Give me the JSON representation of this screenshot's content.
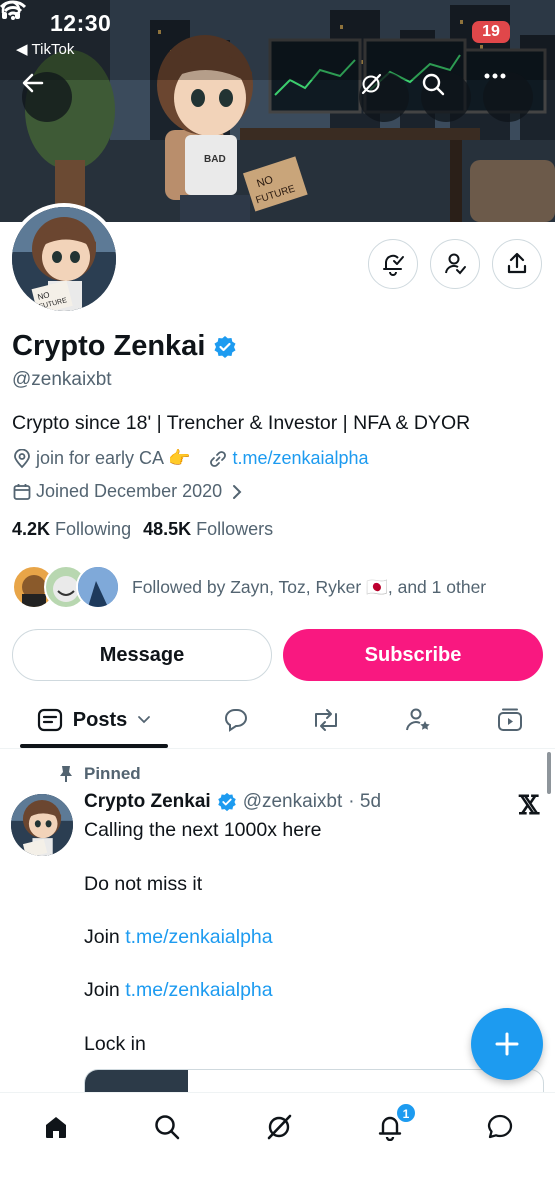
{
  "status_bar": {
    "time": "12:30",
    "back_app": "TikTok",
    "battery": "19"
  },
  "profile": {
    "display_name": "Crypto Zenkai",
    "handle": "@zenkaixbt",
    "bio": "Crypto since 18' | Trencher & Investor | NFA & DYOR",
    "location": "join for early CA 👉",
    "website": "t.me/zenkaialpha",
    "joined": "Joined December 2020",
    "following_count": "4.2K",
    "following_label": "Following",
    "followers_count": "48.5K",
    "followers_label": "Followers",
    "followed_by": "Followed by Zayn, Toz, Ryker 🇯🇵, and 1 other",
    "avatar_sign_text": "NO FUTURE",
    "banner_shirt_text": "BAD",
    "banner_sign_text": "NO FUTURE"
  },
  "buttons": {
    "message": "Message",
    "subscribe": "Subscribe"
  },
  "tabs": {
    "posts": "Posts"
  },
  "pinned_post": {
    "pinned_label": "Pinned",
    "author": "Crypto Zenkai",
    "handle": "@zenkaixbt",
    "time": "· 5d",
    "line1": "Calling the next 1000x here",
    "line2": "Do not miss it",
    "join_word": "Join",
    "join_link": "t.me/zenkaialpha",
    "line5": "Lock in"
  },
  "bottom_nav": {
    "notification_count": "1"
  },
  "colors": {
    "accent": "#1d9bf0",
    "subscribe": "#f91880",
    "text": "#0f1419",
    "muted": "#536471"
  }
}
